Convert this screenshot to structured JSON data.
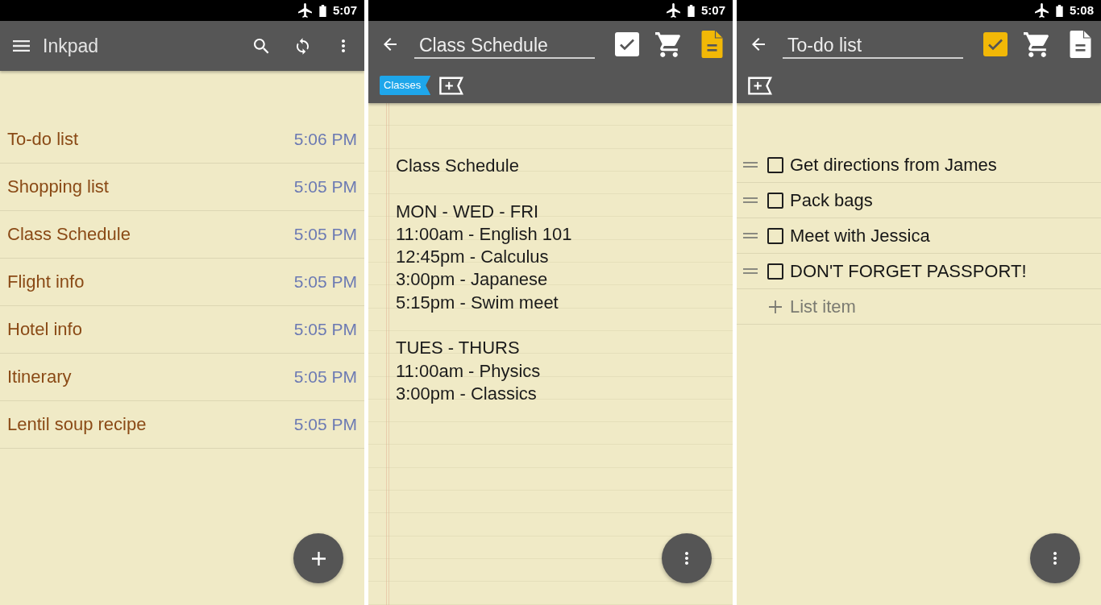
{
  "screens": [
    {
      "kind": "note_list",
      "status_bar": {
        "time": "5:07"
      },
      "toolbar": {
        "title": "Inkpad"
      },
      "notes": [
        {
          "title": "To-do list",
          "time": "5:06 PM"
        },
        {
          "title": "Shopping list",
          "time": "5:05 PM"
        },
        {
          "title": "Class Schedule",
          "time": "5:05 PM"
        },
        {
          "title": "Flight info",
          "time": "5:05 PM"
        },
        {
          "title": "Hotel info",
          "time": "5:05 PM"
        },
        {
          "title": "Itinerary",
          "time": "5:05 PM"
        },
        {
          "title": "Lentil soup recipe",
          "time": "5:05 PM"
        }
      ],
      "fab": {
        "kind": "add"
      }
    },
    {
      "kind": "text_note",
      "status_bar": {
        "time": "5:07"
      },
      "title_field": {
        "value": "Class Schedule"
      },
      "note_types": [
        {
          "kind": "checklist",
          "selected": false
        },
        {
          "kind": "shopping",
          "selected": false
        },
        {
          "kind": "text",
          "selected": true
        }
      ],
      "tags": [
        {
          "label": "Classes"
        }
      ],
      "paragraphs": [
        {
          "lines": [
            "Class Schedule"
          ]
        },
        {
          "lines": [
            "MON - WED - FRI",
            "11:00am - English 101",
            "12:45pm - Calculus",
            "3:00pm - Japanese",
            "5:15pm - Swim meet"
          ]
        },
        {
          "lines": [
            "TUES - THURS",
            "11:00am - Physics",
            "3:00pm - Classics"
          ]
        }
      ],
      "fab": {
        "kind": "more"
      }
    },
    {
      "kind": "checklist",
      "status_bar": {
        "time": "5:08"
      },
      "title_field": {
        "value": "To-do list"
      },
      "note_types": [
        {
          "kind": "checklist",
          "selected": true
        },
        {
          "kind": "shopping",
          "selected": false
        },
        {
          "kind": "text",
          "selected": false
        }
      ],
      "items": [
        {
          "text": "Get directions from James",
          "checked": false
        },
        {
          "text": "Pack bags",
          "checked": false
        },
        {
          "text": "Meet with Jessica",
          "checked": false
        },
        {
          "text": "DON'T FORGET PASSPORT!",
          "checked": false
        }
      ],
      "add_item": {
        "label": "List item"
      },
      "fab": {
        "kind": "more"
      }
    }
  ]
}
